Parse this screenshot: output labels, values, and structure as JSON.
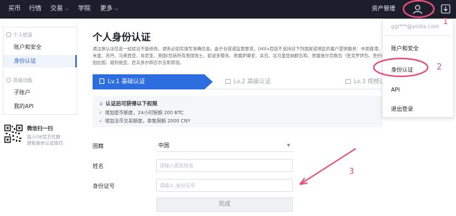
{
  "topbar": {
    "nav": [
      {
        "label": "买币",
        "dropdown": false
      },
      {
        "label": "行情",
        "dropdown": false
      },
      {
        "label": "交易",
        "dropdown": true
      },
      {
        "label": "学院",
        "dropdown": false
      },
      {
        "label": "更多",
        "dropdown": true
      }
    ],
    "asset_label": "资产管理",
    "user_icon": "user-icon",
    "download_icon": "download-icon",
    "background": "#1c1f2b"
  },
  "sidebar": {
    "personal_heading": "个人信息",
    "personal_items": [
      "账户和安全",
      "身份认证"
    ],
    "active_item": "身份认证",
    "advanced_heading": "高级功能",
    "advanced_items": [
      "子账户",
      "我的API"
    ],
    "wechat_title": "微信扫一扫",
    "wechat_line1": "加入OK官方社群",
    "wechat_line2": "获取身份认证技巧"
  },
  "main": {
    "title": "个人身份认证",
    "description_line1": "请注意认证信息一经验证不能修改，请务必如实填写准确信息。由于合规或监管要求，OKEx目前不支持对下列国家或地区的客户提供服务：中国香港、美国、新加坡、古巴、伊朗、朝鲜、叙利亚、苏丹、索",
    "description_line2": "米里、苏丹、马来西亚、肯尼亚、美国(包括所有美国领土、如波多黎各、美属萨摩亚、关岛、北马里亚纳群岛和、美属维尔京群岛（圣克罗伊岛、圣约翰岛和圣托马斯岛），孟",
    "description_line3": "加拉国、玻利维亚、厄瓜多尔和吉尔吉斯斯坦。",
    "steps": [
      {
        "label": "Lv.1 基础认证",
        "active": true
      },
      {
        "label": "Lv.2 高级认证",
        "active": false
      },
      {
        "label": "Lv.3 视频认证",
        "active": false
      }
    ],
    "benefits_title": "认证后可获得以下权限",
    "benefits": [
      "增加提币额度，24小时限额 200 BTC",
      "增加法币交易额度，单笔限额 2000 CNY"
    ],
    "form": {
      "nationality_label": "国籍",
      "nationality_value": "中国",
      "name_label": "姓名",
      "name_placeholder": "请输入真实姓名",
      "id_label": "身份证号",
      "id_placeholder": "请输入 身份证号",
      "submit_label": "完成"
    },
    "accent": "#2c6ee0"
  },
  "dropdown": {
    "email": "ggi***@yodia.com",
    "items": [
      "账户和安全",
      "身份认证",
      "API",
      "退出登录"
    ]
  },
  "annotations": {
    "numbers": [
      "1",
      "2",
      "3"
    ],
    "color": "#e8507a"
  }
}
